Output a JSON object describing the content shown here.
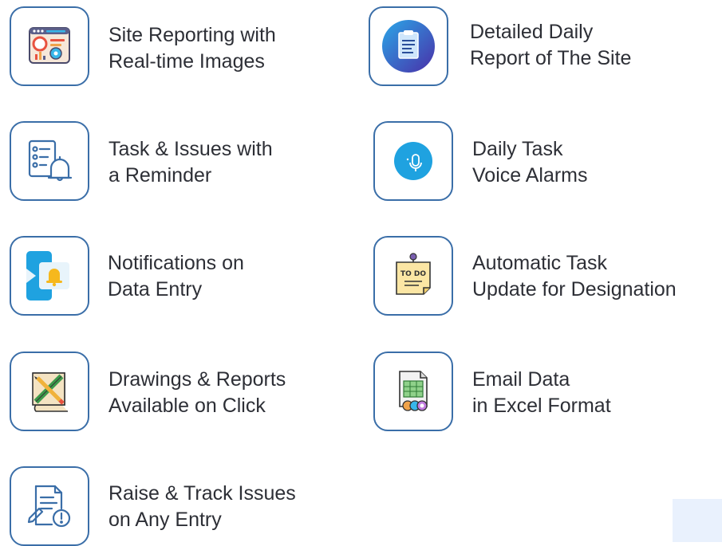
{
  "features": [
    {
      "id": "site-reporting",
      "line1": "Site Reporting with",
      "line2": "Real-time Images",
      "icon": "dashboard-report-icon"
    },
    {
      "id": "daily-report",
      "line1": "Detailed Daily",
      "line2": "Report of The Site",
      "icon": "clipboard-report-icon"
    },
    {
      "id": "task-issues",
      "line1": "Task & Issues with",
      "line2": "a Reminder",
      "icon": "checklist-bell-icon"
    },
    {
      "id": "voice-alarms",
      "line1": "Daily Task",
      "line2": "Voice Alarms",
      "icon": "microphone-icon"
    },
    {
      "id": "notifications",
      "line1": "Notifications on",
      "line2": "Data Entry",
      "icon": "phone-notification-icon"
    },
    {
      "id": "auto-task",
      "line1": "Automatic Task",
      "line2": "Update for Designation",
      "icon": "todo-note-icon"
    },
    {
      "id": "drawings",
      "line1": "Drawings & Reports",
      "line2": "Available on Click",
      "icon": "blueprint-tools-icon"
    },
    {
      "id": "email-excel",
      "line1": "Email Data",
      "line2": "in Excel Format",
      "icon": "spreadsheet-icon"
    },
    {
      "id": "raise-issues",
      "line1": "Raise & Track Issues",
      "line2": "on Any Entry",
      "icon": "document-alert-icon"
    }
  ],
  "todo_text": "TO DO",
  "colors": {
    "border": "#3a6ea8",
    "accent_blue": "#1fa2e0",
    "corner": "#e9f1fd"
  }
}
